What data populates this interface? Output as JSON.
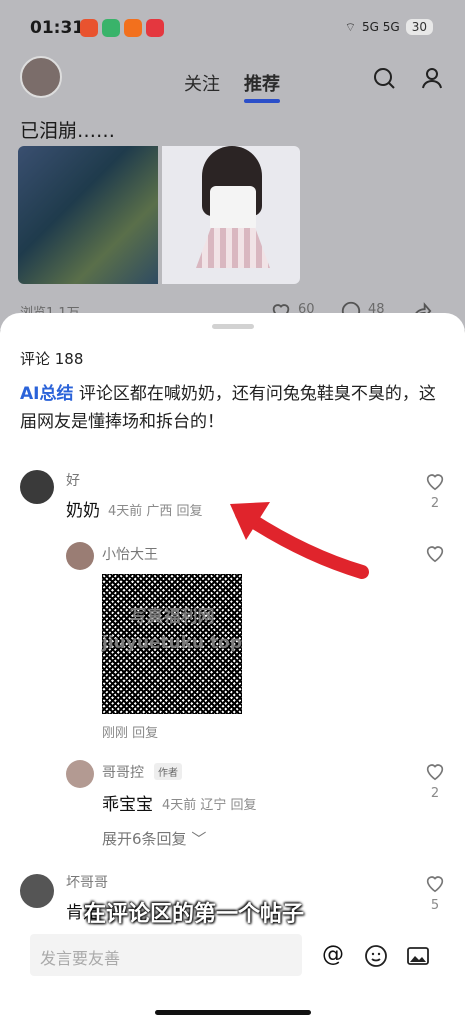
{
  "status_bar": {
    "time": "01:31",
    "signal": "5G 5G",
    "battery": "30"
  },
  "top_nav": {
    "tabs": [
      "关注",
      "推荐"
    ],
    "active_tab": "推荐"
  },
  "post": {
    "title": "已泪崩……",
    "views": "浏览1.1万",
    "likes": "60",
    "comments": "48"
  },
  "comments_sheet": {
    "count_label": "评论 188",
    "ai_summary": {
      "label": "AI总结",
      "text": " 评论区都在喊奶奶，还有问兔兔鞋臭不臭的，这届网友是懂捧场和拆台的！"
    },
    "comments": [
      {
        "name": "好",
        "text": "奶奶",
        "meta": "4天前 广西 回复",
        "likes": "2"
      },
      {
        "name": "小怡大王",
        "meta": "刚刚 回复",
        "image_text": "写真福利网 jiuyuetuku top"
      },
      {
        "name": "哥哥控",
        "badge": "作者",
        "text": "乖宝宝",
        "meta": "4天前 辽宁 回复",
        "likes": "2"
      },
      {
        "name": "坏哥哥",
        "text": "肯定",
        "likes": "5"
      }
    ],
    "expand_label": "展开6条回复"
  },
  "overlay_caption": "在评论区的第一个帖子",
  "composer": {
    "placeholder": "发言要友善"
  },
  "accent_color": "#2b63d9"
}
